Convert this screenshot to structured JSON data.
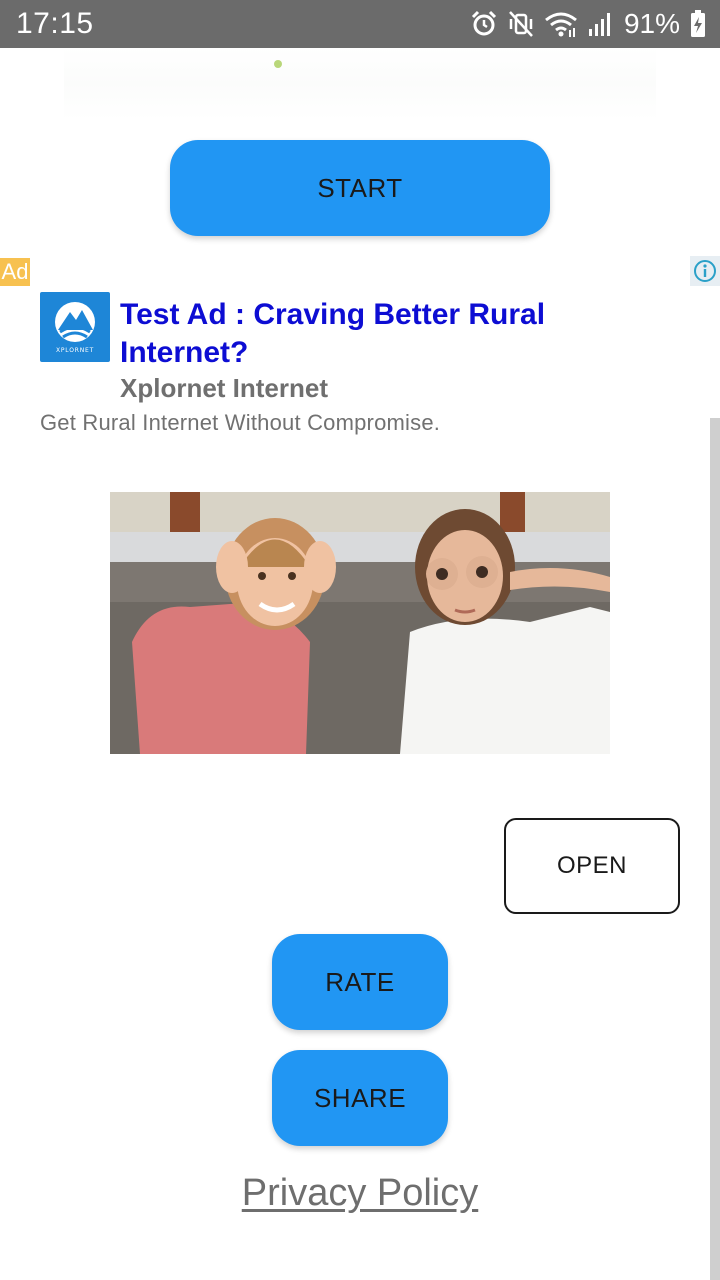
{
  "status_bar": {
    "time": "17:15",
    "battery_percent": "91%",
    "icons": [
      "alarm-icon",
      "mute-vibrate-icon",
      "wifi-icon",
      "signal-icon",
      "battery-charging-icon"
    ]
  },
  "main": {
    "start_label": "START",
    "rate_label": "RATE",
    "share_label": "SHARE",
    "privacy_label": "Privacy Policy"
  },
  "ad": {
    "badge": "Ad",
    "logo_text": "XPLORNET",
    "headline": "Test Ad : Craving Better Rural Internet?",
    "advertiser": "Xplornet Internet",
    "body": "Get Rural Internet Without Compromise.",
    "open_label": "OPEN",
    "image_subject": "two children on a sofa making glasses shapes with their hands"
  },
  "colors": {
    "accent": "#2196f3",
    "ad_headline": "#0d0dd3",
    "ad_badge": "#f7c150",
    "status_bar": "#6b6b6b"
  }
}
